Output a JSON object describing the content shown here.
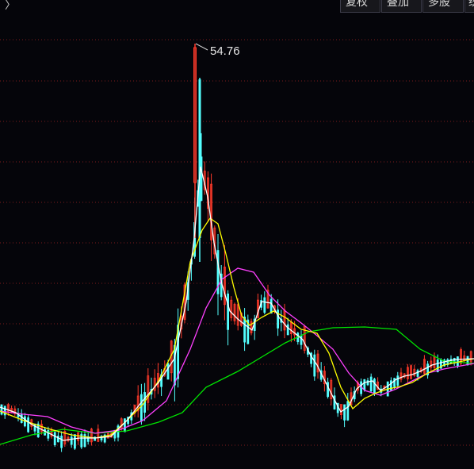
{
  "toolbar": {
    "nav_icon": "chevron-right-icon",
    "buttons": [
      {
        "label": "复权"
      },
      {
        "label": "叠加"
      },
      {
        "label": "多股"
      },
      {
        "label": "统"
      }
    ]
  },
  "colors": {
    "background": "#05050a",
    "up_candle": "#ff3a2a",
    "down_candle": "#54ffff",
    "ma5": "#ffffff",
    "ma10": "#ffff00",
    "ma20": "#ff40ff",
    "ma60": "#00e600",
    "grid": "#8a1e1e"
  },
  "chart_data": {
    "type": "candlestick",
    "title": "",
    "peak_annotation": "54.76",
    "ma_series": [
      {
        "color_key": "ma5"
      },
      {
        "color_key": "ma10"
      },
      {
        "color_key": "ma20"
      },
      {
        "color_key": "ma60"
      }
    ],
    "grid": true,
    "grid_style": "dotted"
  }
}
